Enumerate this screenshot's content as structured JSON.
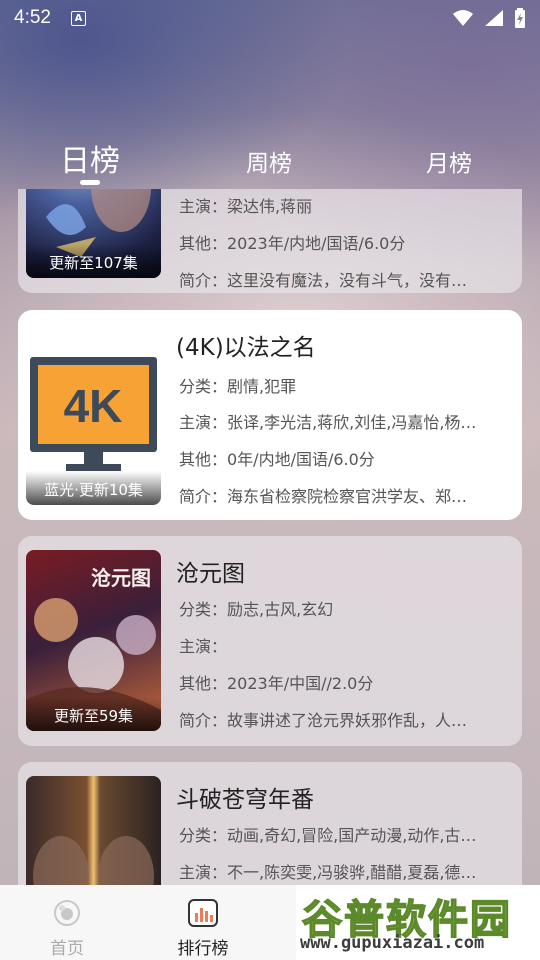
{
  "status_bar": {
    "time": "4:52",
    "a_badge": "A"
  },
  "tabs": [
    {
      "label": "日榜",
      "active": true
    },
    {
      "label": "周榜",
      "active": false
    },
    {
      "label": "月榜",
      "active": false
    }
  ],
  "cards": [
    {
      "title": "",
      "badge": "更新至107集",
      "lines": [
        "主演：梁达伟,蒋丽",
        "其他：2023年/内地/国语/6.0分",
        "简介：这里没有魔法，没有斗气，没有…"
      ]
    },
    {
      "title": "(4K)以法之名",
      "badge": "蓝光·更新10集",
      "poster_text": "4K",
      "lines": [
        "分类：剧情,犯罪",
        "主演：张译,李光洁,蒋欣,刘佳,冯嘉怡,杨…",
        "其他：0年/内地/国语/6.0分",
        "简介：海东省检察院检察官洪学友、郑…"
      ]
    },
    {
      "title": "沧元图",
      "badge": "更新至59集",
      "poster_text": "沧元图",
      "lines": [
        "分类：励志,古风,玄幻",
        "主演：",
        "其他：2023年/中国//2.0分",
        "简介：故事讲述了沧元界妖邪作乱，人…"
      ]
    },
    {
      "title": "斗破苍穹年番",
      "badge": "",
      "lines": [
        "分类：动画,奇幻,冒险,国产动漫,动作,古…",
        "主演：不一,陈奕雯,冯骏骅,醋醋,夏磊,德…"
      ]
    }
  ],
  "bottom_nav": [
    {
      "label": "首页",
      "active": false
    },
    {
      "label": "排行榜",
      "active": true
    }
  ],
  "watermark": {
    "title": "谷普软件园",
    "url": "www.gupuxiazai.com"
  },
  "colors": {
    "card_white": "#ffffff",
    "card_gray": "#e6e2e6",
    "poster_orange": "#f7a234",
    "poster_dark": "#3d4a5a",
    "watermark_green": "#9bc24a"
  }
}
